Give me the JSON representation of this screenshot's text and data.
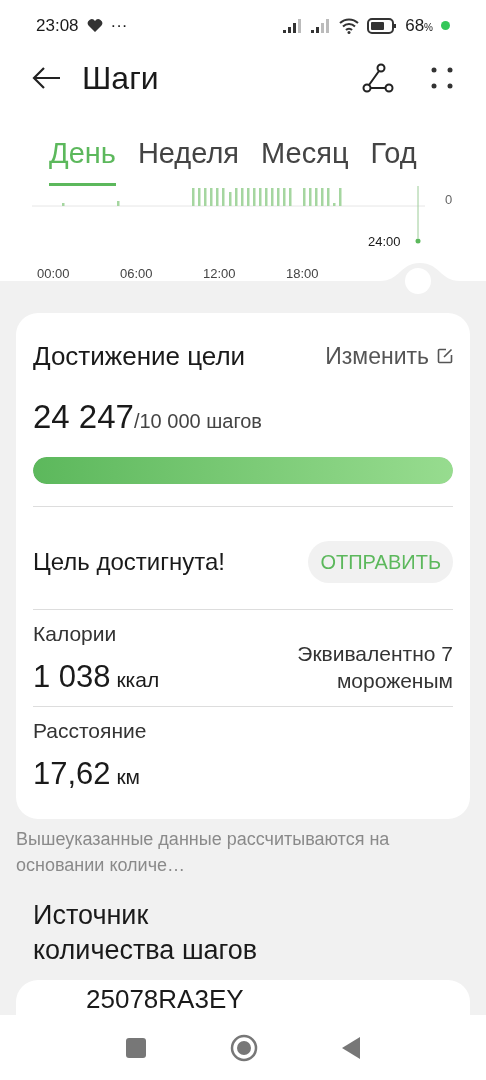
{
  "status_bar": {
    "time": "23:08",
    "more": "···",
    "battery": "68",
    "battery_unit": "%"
  },
  "header": {
    "title": "Шаги"
  },
  "tabs": [
    {
      "label": "День",
      "selected": true
    },
    {
      "label": "Неделя",
      "selected": false
    },
    {
      "label": "Месяц",
      "selected": false
    },
    {
      "label": "Год",
      "selected": false
    }
  ],
  "chart": {
    "y_label": "0",
    "cursor_label": "24:00",
    "x_labels": [
      "00:00",
      "06:00",
      "12:00",
      "18:00"
    ]
  },
  "goal": {
    "title": "Достижение цели",
    "edit": "Изменить",
    "steps": "24 247",
    "target": "/10 000 шагов",
    "level": 1,
    "status": "Цель достигнута!",
    "share": "ОТПРАВИТЬ"
  },
  "stats": [
    {
      "label": "Калории",
      "value": "1 038",
      "unit": "ккал",
      "note": "Эквивалентно 7 мороженым"
    },
    {
      "label": "Расстояние",
      "value": "17,62",
      "unit": "км"
    }
  ],
  "footnote": "Вышеуказанные данные рассчитываются на основании количе…",
  "source": {
    "title": "Источник количества шагов",
    "device": "25078RA3EY"
  }
}
